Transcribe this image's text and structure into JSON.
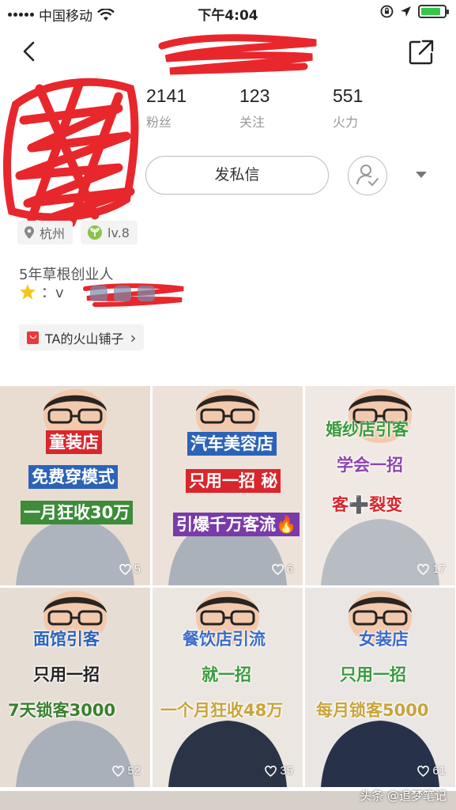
{
  "status_bar": {
    "carrier": "中国移动",
    "time": "下午4:04"
  },
  "profile": {
    "stats": [
      {
        "value": "2141",
        "label": "粉丝"
      },
      {
        "value": "123",
        "label": "关注"
      },
      {
        "value": "551",
        "label": "火力"
      }
    ],
    "message_button": "发私信",
    "tags": [
      {
        "icon": "location-icon",
        "label": "杭州"
      },
      {
        "icon": "level-icon",
        "label": "lv.8"
      }
    ],
    "bio_line1": "5年草根创业人",
    "bio_prefix": "：v",
    "shop_label": "TA的火山铺子",
    "shop_chevron": "›"
  },
  "videos": [
    {
      "captions": [
        "童装店",
        "免费穿模式",
        "一月狂收30万"
      ],
      "likes": "5"
    },
    {
      "captions": [
        "汽车美容店",
        "只用一招 秘",
        "引爆千万客流🔥"
      ],
      "likes": "6"
    },
    {
      "captions": [
        "婚纱店引客",
        "学会一招",
        "客➕裂变"
      ],
      "likes": "17"
    },
    {
      "captions": [
        "面馆引客",
        "只用一招",
        "7天锁客3000"
      ],
      "likes": "52"
    },
    {
      "captions": [
        "餐饮店引流",
        "就一招",
        "一个月狂收48万"
      ],
      "likes": "35"
    },
    {
      "captions": [
        "女装店",
        "只用一招",
        "每月锁客5000"
      ],
      "likes": "61"
    }
  ],
  "watermark": "头条 @追梦笔记",
  "colors": {
    "accent_red": "#e8272d",
    "battery_green": "#33c748"
  }
}
